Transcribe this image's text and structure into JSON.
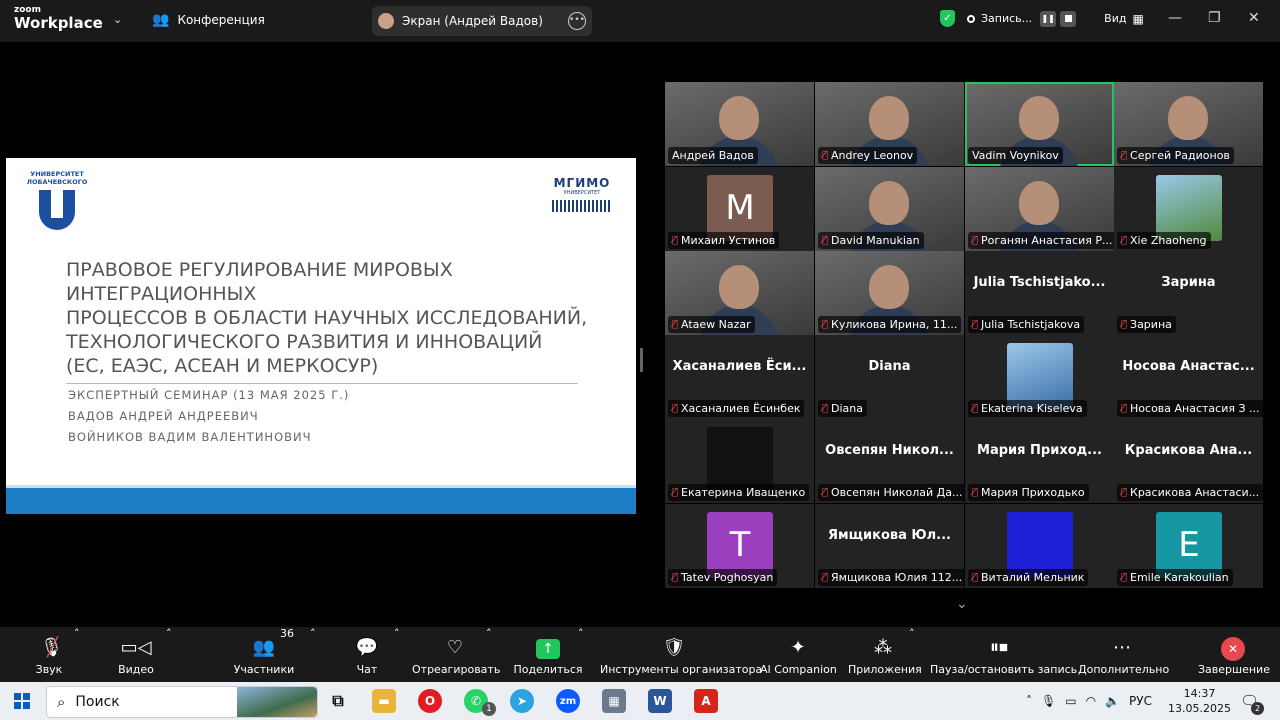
{
  "app": {
    "logo_top": "zoom",
    "logo_bottom": "Workplace",
    "meeting_label": "Конференция"
  },
  "share": {
    "label": "Экран (Андрей Вадов)"
  },
  "status": {
    "recording_label": "Запись...",
    "view_label": "Вид"
  },
  "slide": {
    "title_lines": [
      "ПРАВОВОЕ РЕГУЛИРОВАНИЕ МИРОВЫХ",
      "ИНТЕГРАЦИОННЫХ",
      "ПРОЦЕССОВ В ОБЛАСТИ НАУЧНЫХ ИССЛЕДОВАНИЙ,",
      "ТЕХНОЛОГИЧЕСКОГО РАЗВИТИЯ И ИННОВАЦИЙ",
      "(ЕС, ЕАЭС, АСЕАН И МЕРКОСУР)"
    ],
    "subtitle": "ЭКСПЕРТНЫЙ СЕМИНАР (13 МАЯ 2025 Г.)",
    "author1": "ВАДОВ АНДРЕЙ АНДРЕЕВИЧ",
    "author2": "ВОЙНИКОВ ВАДИМ ВАЛЕНТИНОВИЧ",
    "logo_left": "УНИВЕРСИТЕТ ЛОБАЧЕВСКОГО",
    "logo_right": "МГИМО",
    "logo_right_sub": "УНИВЕРСИТЕТ"
  },
  "participants": [
    {
      "name": "Андрей Вадов",
      "type": "video",
      "muted": false
    },
    {
      "name": "Andrey Leonov",
      "type": "video",
      "muted": true
    },
    {
      "name": "Vadim Voynikov",
      "type": "video",
      "muted": false,
      "active": true
    },
    {
      "name": "Сергей Радионов",
      "type": "video",
      "muted": true
    },
    {
      "name": "Михаил Устинов",
      "type": "avatar",
      "letter": "M",
      "color": "#7a5c50",
      "muted": true
    },
    {
      "name": "David Manukian",
      "type": "video",
      "muted": true
    },
    {
      "name": "Роганян Анастасия Р...",
      "type": "video",
      "muted": true
    },
    {
      "name": "Xie Zhaoheng",
      "type": "image",
      "color": "#4f8a3c",
      "muted": true
    },
    {
      "name": "Ataew Nazar",
      "type": "video",
      "muted": true
    },
    {
      "name": "Куликова Ирина, 11...",
      "type": "video",
      "muted": true
    },
    {
      "name": "Julia Tschistjakova",
      "type": "text",
      "display": "Julia Tschistjako...",
      "muted": true
    },
    {
      "name": "Зарина",
      "type": "text",
      "display": "Зарина",
      "muted": true
    },
    {
      "name": "Хасаналиев Ёсинбек",
      "type": "text",
      "display": "Хасаналиев Ёси...",
      "muted": true
    },
    {
      "name": "Diana",
      "type": "text",
      "display": "Diana",
      "muted": true
    },
    {
      "name": "Ekaterina Kiseleva",
      "type": "image",
      "color": "#3b6ea8",
      "muted": true
    },
    {
      "name": "Носова Анастасия З ...",
      "type": "text",
      "display": "Носова Анастас...",
      "muted": true
    },
    {
      "name": "Екатерина Иващенко",
      "type": "avatar",
      "letter": "",
      "color": "#111111",
      "muted": true
    },
    {
      "name": "Овсепян Николай Да...",
      "type": "text",
      "display": "Овсепян Никол...",
      "muted": true
    },
    {
      "name": "Мария Приходько",
      "type": "text",
      "display": "Мария Приход...",
      "muted": true
    },
    {
      "name": "Красикова Анастаси...",
      "type": "text",
      "display": "Красикова Ана...",
      "muted": true
    },
    {
      "name": "Tatev Poghosyan",
      "type": "avatar",
      "letter": "T",
      "color": "#9b3fbf",
      "muted": true
    },
    {
      "name": "Ямщикова Юлия 112...",
      "type": "text",
      "display": "Ямщикова Юл...",
      "muted": true
    },
    {
      "name": "Виталий Мельник",
      "type": "avatar",
      "letter": "",
      "color": "#1f1fd6",
      "muted": true
    },
    {
      "name": "Emile Karakoulian",
      "type": "avatar",
      "letter": "E",
      "color": "#1696a3",
      "muted": true
    }
  ],
  "toolbar": {
    "mute": "Звук",
    "video": "Видео",
    "participants": "Участники",
    "participants_count": "36",
    "chat": "Чат",
    "react": "Отреагировать",
    "share": "Поделиться",
    "host_tools": "Инструменты организатора",
    "ai": "AI Companion",
    "apps": "Приложения",
    "pause_rec": "Пауза/остановить запись",
    "more": "Дополнительно",
    "end": "Завершение"
  },
  "taskbar": {
    "search_placeholder": "Поиск",
    "lang": "РУС",
    "time": "14:37",
    "date": "13.05.2025",
    "notif_count": "2",
    "whatsapp_badge": "1"
  }
}
